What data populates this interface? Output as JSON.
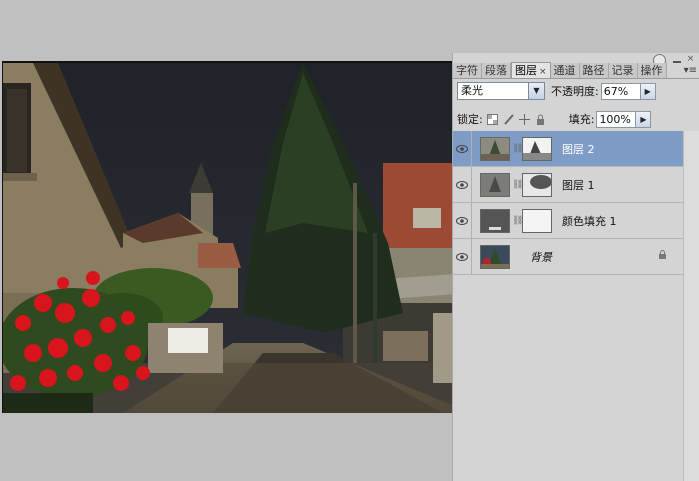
{
  "panel": {
    "tabs": [
      {
        "label": "字符",
        "active": false
      },
      {
        "label": "段落",
        "active": false
      },
      {
        "label": "图层",
        "active": true
      },
      {
        "label": "通道",
        "active": false
      },
      {
        "label": "路径",
        "active": false
      },
      {
        "label": "记录",
        "active": false
      },
      {
        "label": "操作",
        "active": false
      }
    ],
    "tab_close": "×",
    "menu_glyph": "▾≡",
    "minimize_glyph": "",
    "close_glyph": "×"
  },
  "blend": {
    "mode": "柔光",
    "opacity_label": "不透明度:",
    "opacity_value": "67%"
  },
  "lock": {
    "label": "锁定:",
    "fill_label": "填充:",
    "fill_value": "100%"
  },
  "layers": [
    {
      "name": "图层 2",
      "selected": true,
      "italic": false,
      "has_mask": true
    },
    {
      "name": "图层 1",
      "selected": false,
      "italic": false,
      "has_mask": true
    },
    {
      "name": "颜色填充 1",
      "selected": false,
      "italic": false,
      "has_mask": true
    },
    {
      "name": "背景",
      "selected": false,
      "italic": true,
      "has_mask": false,
      "locked": true
    }
  ],
  "colors": {
    "selection": "#7e9cc6",
    "panel_bg": "#d4d4d4",
    "canvas_bg": "#c0c0c0"
  }
}
